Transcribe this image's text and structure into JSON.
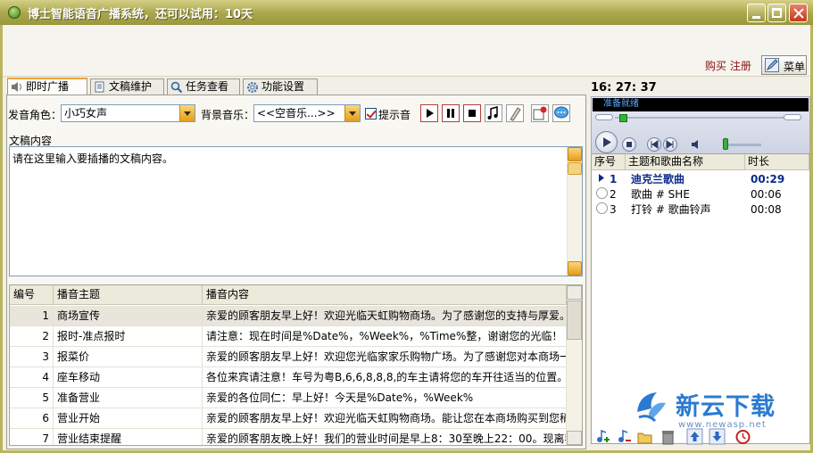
{
  "window": {
    "title": "博士智能语音广播系统，还可以试用：10天"
  },
  "header": {
    "buy_register": "购买 注册",
    "menu_label": "菜单"
  },
  "tabs": [
    {
      "label": "即时广播",
      "icon": "speaker-icon",
      "active": true
    },
    {
      "label": "文稿维护",
      "icon": "document-icon",
      "active": false
    },
    {
      "label": "任务查看",
      "icon": "magnifier-icon",
      "active": false
    },
    {
      "label": "功能设置",
      "icon": "gear-icon",
      "active": false
    }
  ],
  "broadcast": {
    "voice_label": "发音角色：",
    "voice_value": "小巧女声",
    "bgm_label": "背景音乐：",
    "bgm_value": "<<空音乐...>>",
    "tone_label": "提示音",
    "tone_checked": true,
    "content_label": "文稿内容",
    "content_text": "请在这里输入要插播的文稿内容。"
  },
  "table": {
    "columns": [
      "编号",
      "播音主题",
      "播音内容"
    ],
    "rows": [
      {
        "id": "1",
        "topic": "商场宣传",
        "content": "亲爱的顾客朋友早上好！欢迎光临天虹购物商场。为了感谢您的支持与厚爱。"
      },
      {
        "id": "2",
        "topic": "报时-准点报时",
        "content": "请注意：现在时间是%Date%，%Week%，%Time%整，谢谢您的光临！"
      },
      {
        "id": "3",
        "topic": "报菜价",
        "content": "亲爱的顾客朋友早上好！欢迎您光临家家乐购物广场。为了感谢您对本商场一"
      },
      {
        "id": "4",
        "topic": "座车移动",
        "content": "各位来宾请注意！车号为粤B,6,6,8,8,8,的车主请将您的车开往适当的位置。"
      },
      {
        "id": "5",
        "topic": "准备营业",
        "content": "亲爱的各位同仁：早上好！今天是%Date%，%Week%"
      },
      {
        "id": "6",
        "topic": "营业开始",
        "content": "亲爱的顾客朋友早上好！欢迎光临天虹购物商场。能让您在本商场购买到您稍"
      },
      {
        "id": "7",
        "topic": "营业结束提醒",
        "content": "亲爱的顾客朋友晚上好！我们的营业时间是早上8：30至晚上22：00。现离我"
      }
    ]
  },
  "player": {
    "clock": "16: 27: 37",
    "status": "准备就绪"
  },
  "playlist": {
    "columns": [
      "序号",
      "主题和歌曲名称",
      "时长"
    ],
    "rows": [
      {
        "no": "1",
        "title": "迪克兰歌曲",
        "duration": "00:29",
        "playing": true
      },
      {
        "no": "2",
        "title": "歌曲 # SHE",
        "duration": "00:06",
        "playing": false
      },
      {
        "no": "3",
        "title": "打铃 # 歌曲铃声",
        "duration": "00:08",
        "playing": false
      }
    ]
  },
  "watermark": {
    "name": "新云下载",
    "url": "www.newasp.net"
  }
}
